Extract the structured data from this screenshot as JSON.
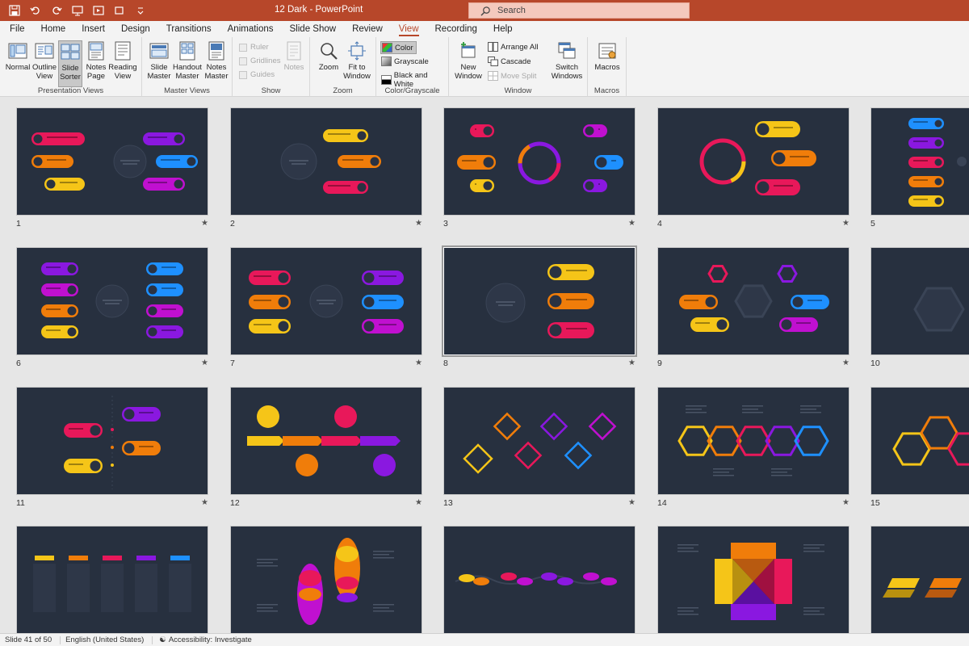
{
  "window": {
    "title": "12 Dark  -  PowerPoint",
    "search_placeholder": "Search"
  },
  "tabs": [
    {
      "label": "File"
    },
    {
      "label": "Home"
    },
    {
      "label": "Insert"
    },
    {
      "label": "Design"
    },
    {
      "label": "Transitions"
    },
    {
      "label": "Animations"
    },
    {
      "label": "Slide Show"
    },
    {
      "label": "Review"
    },
    {
      "label": "View",
      "active": true
    },
    {
      "label": "Recording"
    },
    {
      "label": "Help"
    }
  ],
  "ribbon": {
    "presentation_views": {
      "label": "Presentation Views",
      "normal": "Normal",
      "outline": "Outline View",
      "slide_sorter": "Slide Sorter",
      "notes_page": "Notes Page",
      "reading": "Reading View"
    },
    "master_views": {
      "label": "Master Views",
      "slide_master": "Slide Master",
      "handout_master": "Handout Master",
      "notes_master": "Notes Master"
    },
    "show": {
      "label": "Show",
      "ruler": "Ruler",
      "gridlines": "Gridlines",
      "guides": "Guides",
      "notes": "Notes"
    },
    "zoom": {
      "label": "Zoom",
      "zoom": "Zoom",
      "fit": "Fit to Window"
    },
    "color": {
      "label": "Color/Grayscale",
      "color": "Color",
      "grayscale": "Grayscale",
      "bw": "Black and White"
    },
    "window": {
      "label": "Window",
      "new_window": "New Window",
      "arrange_all": "Arrange All",
      "cascade": "Cascade",
      "move_split": "Move Split",
      "switch": "Switch Windows"
    },
    "macros": {
      "label": "Macros",
      "macros": "Macros"
    }
  },
  "slides": [
    {
      "number": "1"
    },
    {
      "number": "2"
    },
    {
      "number": "3"
    },
    {
      "number": "4"
    },
    {
      "number": "5"
    },
    {
      "number": "6"
    },
    {
      "number": "7"
    },
    {
      "number": "8",
      "selected": true
    },
    {
      "number": "9"
    },
    {
      "number": "10"
    },
    {
      "number": "11"
    },
    {
      "number": "12"
    },
    {
      "number": "13"
    },
    {
      "number": "14"
    },
    {
      "number": "15"
    },
    {
      "number": ""
    },
    {
      "number": ""
    },
    {
      "number": ""
    },
    {
      "number": ""
    },
    {
      "number": ""
    }
  ],
  "status": {
    "slide_info": "Slide 41 of 50",
    "language": "English (United States)",
    "accessibility": "Accessibility: Investigate"
  },
  "colors": {
    "accent": "#b7472a",
    "slide_bg": "#27303f",
    "yellow": "#f5c518",
    "orange": "#f07d0a",
    "red": "#e8185a",
    "purple": "#8a18e0",
    "blue": "#1e90ff",
    "magenta": "#c010d0"
  }
}
